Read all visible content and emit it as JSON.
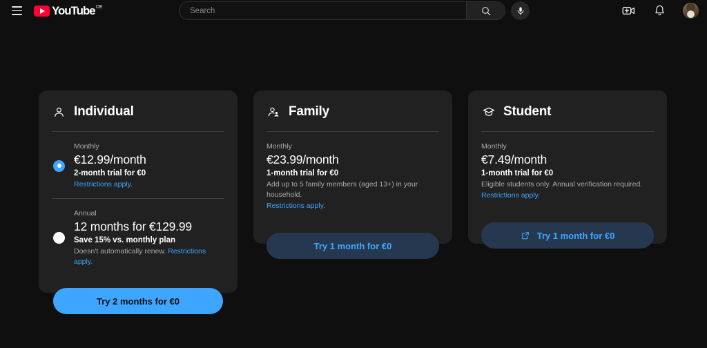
{
  "header": {
    "menu_icon": "hamburger-menu-icon",
    "logo_text": "YouTube",
    "logo_country": "DE",
    "search_placeholder": "Search",
    "search_value": "",
    "search_icon": "search-icon",
    "mic_icon": "microphone-icon",
    "create_icon": "create-video-icon",
    "notifications_icon": "bell-icon",
    "avatar_icon": "user-avatar"
  },
  "plans": [
    {
      "id": "individual",
      "title": "Individual",
      "icon": "person-icon",
      "options": [
        {
          "period": "Monthly",
          "price": "€12.99/month",
          "subtitle": "2-month trial for €0",
          "note": "",
          "link": "Restrictions apply.",
          "selected": true
        },
        {
          "period": "Annual",
          "price": "12 months for €129.99",
          "subtitle": "Save 15% vs. monthly plan",
          "note": "Doesn't automatically renew.",
          "link": "Restrictions apply.",
          "selected": false
        }
      ],
      "cta_label": "Try 2 months for €0",
      "cta_style": "primary",
      "cta_icon": ""
    },
    {
      "id": "family",
      "title": "Family",
      "icon": "people-group-icon",
      "options": [
        {
          "period": "Monthly",
          "price": "€23.99/month",
          "subtitle": "1-month trial for €0",
          "note": "Add up to 5 family members (aged 13+) in your household.",
          "link": "Restrictions apply.",
          "selected": false
        }
      ],
      "cta_label": "Try 1 month for €0",
      "cta_style": "secondary",
      "cta_icon": ""
    },
    {
      "id": "student",
      "title": "Student",
      "icon": "graduation-cap-icon",
      "options": [
        {
          "period": "Monthly",
          "price": "€7.49/month",
          "subtitle": "1-month trial for €0",
          "note": "Eligible students only. Annual verification required.",
          "link": "Restrictions apply.",
          "selected": false
        }
      ],
      "cta_label": "Try 1 month for €0",
      "cta_style": "secondary",
      "cta_icon": "open-in-new-icon"
    }
  ],
  "colors": {
    "page_background": "#0f0f0f",
    "card_background": "#212121",
    "accent_blue": "#3ea6ff",
    "secondary_button": "#263850",
    "brand_red": "#ff0033"
  }
}
